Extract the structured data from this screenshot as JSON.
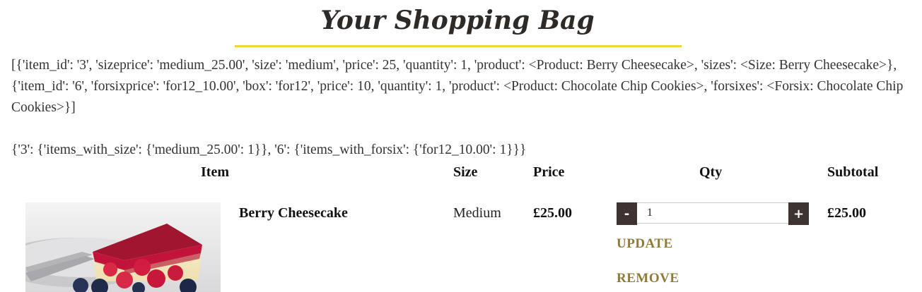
{
  "header": {
    "title": "Your Shopping Bag"
  },
  "debug": {
    "line1": "[{'item_id': '3', 'sizeprice': 'medium_25.00', 'size': 'medium', 'price': 25, 'quantity': 1, 'product': <Product: Berry Cheesecake>, 'sizes': <Size: Berry Cheesecake>}, {'item_id': '6', 'forsixprice': 'for12_10.00', 'box': 'for12', 'price': 10, 'quantity': 1, 'product': <Product: Chocolate Chip Cookies>, 'forsixes': <Forsix: Chocolate Chip Cookies>}]",
    "line2": "{'3': {'items_with_size': {'medium_25.00': 1}}, '6': {'items_with_forsix': {'for12_10.00': 1}}}"
  },
  "table": {
    "headers": {
      "item": "Item",
      "size": "Size",
      "price": "Price",
      "qty": "Qty",
      "subtotal": "Subtotal"
    },
    "rows": [
      {
        "name": "Berry Cheesecake",
        "size": "Medium",
        "price": "£25.00",
        "quantity": "1",
        "subtotal": "£25.00",
        "image_icon": "cheesecake-image"
      }
    ]
  },
  "actions": {
    "decrement": "-",
    "increment": "+",
    "update": "UPDATE",
    "remove": "REMOVE"
  },
  "colors": {
    "accent_underline": "#f2d437",
    "button_dark": "#3d3431",
    "link_gold": "#8e7a3a"
  }
}
